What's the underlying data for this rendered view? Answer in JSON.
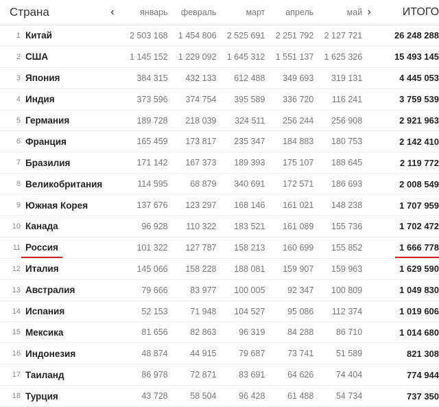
{
  "header": {
    "country_label": "Страна",
    "prev_icon": "chevron-left-icon",
    "next_icon": "chevron-right-icon",
    "months": [
      "январь",
      "февраль",
      "март",
      "апрель",
      "май"
    ],
    "total_label": "ИТОГО"
  },
  "highlight_color": "#d01f1f",
  "rows": [
    {
      "rank": "1",
      "country": "Китай",
      "m": [
        "2 503 168",
        "1 454 806",
        "2 525 691",
        "2 251 792",
        "2 127 721"
      ],
      "total": "26 248 288"
    },
    {
      "rank": "2",
      "country": "США",
      "m": [
        "1 145 152",
        "1 229 092",
        "1 645 312",
        "1 551 137",
        "1 625 326"
      ],
      "total": "15 493 145"
    },
    {
      "rank": "3",
      "country": "Япония",
      "m": [
        "384 315",
        "432 133",
        "612 488",
        "349 693",
        "319 131"
      ],
      "total": "4 445 053"
    },
    {
      "rank": "4",
      "country": "Индия",
      "m": [
        "373 596",
        "374 754",
        "395 589",
        "336 720",
        "116 241"
      ],
      "total": "3 759 539"
    },
    {
      "rank": "5",
      "country": "Германия",
      "m": [
        "189 728",
        "218 039",
        "324 511",
        "256 244",
        "256 908"
      ],
      "total": "2 921 963"
    },
    {
      "rank": "6",
      "country": "Франция",
      "m": [
        "165 459",
        "173 817",
        "235 347",
        "184 883",
        "180 753"
      ],
      "total": "2 142 410"
    },
    {
      "rank": "7",
      "country": "Бразилия",
      "m": [
        "171 142",
        "167 373",
        "189 393",
        "175 107",
        "188 645"
      ],
      "total": "2 119 772"
    },
    {
      "rank": "8",
      "country": "Великобритания",
      "m": [
        "114 595",
        "68 879",
        "340 691",
        "172 571",
        "186 693"
      ],
      "total": "2 008 549"
    },
    {
      "rank": "9",
      "country": "Южная Корея",
      "m": [
        "137 676",
        "123 297",
        "168 146",
        "161 021",
        "148 238"
      ],
      "total": "1 707 959"
    },
    {
      "rank": "10",
      "country": "Канада",
      "m": [
        "96 928",
        "110 322",
        "183 521",
        "161 089",
        "155 736"
      ],
      "total": "1 702 472"
    },
    {
      "rank": "11",
      "country": "Россия",
      "m": [
        "101 322",
        "127 787",
        "158 213",
        "160 699",
        "155 852"
      ],
      "total": "1 666 778",
      "highlighted": true
    },
    {
      "rank": "12",
      "country": "Италия",
      "m": [
        "145 066",
        "158 228",
        "188 081",
        "159 907",
        "159 963"
      ],
      "total": "1 629 590"
    },
    {
      "rank": "13",
      "country": "Австралия",
      "m": [
        "79 666",
        "83 977",
        "100 005",
        "92 347",
        "100 809"
      ],
      "total": "1 049 830"
    },
    {
      "rank": "14",
      "country": "Испания",
      "m": [
        "52 153",
        "71 948",
        "104 527",
        "95 086",
        "112 374"
      ],
      "total": "1 019 606"
    },
    {
      "rank": "15",
      "country": "Мексика",
      "m": [
        "81 656",
        "82 863",
        "96 319",
        "84 288",
        "86 710"
      ],
      "total": "1 014 680"
    },
    {
      "rank": "16",
      "country": "Индонезия",
      "m": [
        "48 874",
        "44 915",
        "79 687",
        "73 741",
        "51 589"
      ],
      "total": "821 308"
    },
    {
      "rank": "17",
      "country": "Таиланд",
      "m": [
        "86 978",
        "72 871",
        "83 691",
        "64 626",
        "74 404"
      ],
      "total": "774 944"
    },
    {
      "rank": "18",
      "country": "Турция",
      "m": [
        "43 728",
        "58 504",
        "96 428",
        "61 488",
        "54 734"
      ],
      "total": "737 350"
    }
  ]
}
